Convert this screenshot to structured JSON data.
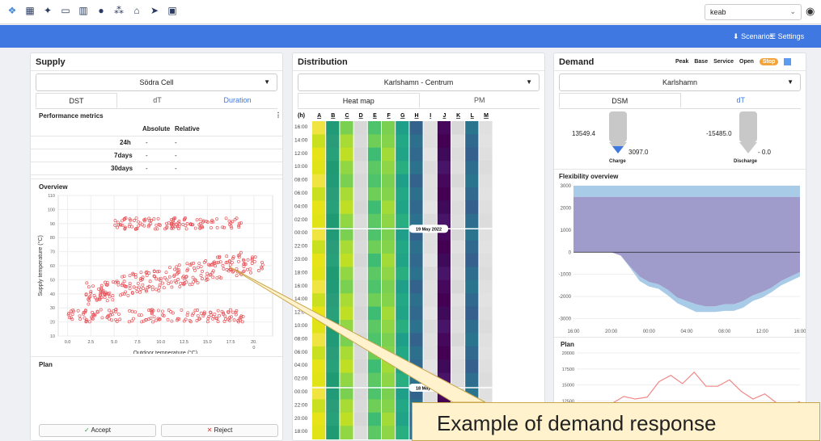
{
  "topbar": {
    "icons": [
      "app-logo-icon",
      "map-icon",
      "bell-icon",
      "monitor-icon",
      "building-icon",
      "clock-icon",
      "network-icon",
      "home-icon",
      "send-icon",
      "calendar-icon"
    ],
    "user_select": "keab"
  },
  "navbar": {
    "scenarios": "Scenarios",
    "settings": "Settings"
  },
  "supply": {
    "title": "Supply",
    "plant": "Södra Cell",
    "tabs": [
      "DST",
      "dT",
      "Duration"
    ],
    "performance_title": "Performance metrics",
    "col_absolute": "Absolute",
    "col_relative": "Relative",
    "rows": [
      {
        "label": "24h",
        "abs": "-",
        "rel": "-"
      },
      {
        "label": "7days",
        "abs": "-",
        "rel": "-"
      },
      {
        "label": "30days",
        "abs": "-",
        "rel": "-"
      }
    ],
    "overview_title": "Overview",
    "plan_title": "Plan",
    "accept": "Accept",
    "reject": "Reject"
  },
  "scatter_data": {
    "type": "scatter",
    "xlabel": "Outdoor temperature (°C)",
    "ylabel": "Supply temperature (°C)",
    "xlim": [
      -1,
      22
    ],
    "ylim": [
      10,
      110
    ],
    "x_ticks": [
      "0.0",
      "2.5",
      "5.0",
      "7.5",
      "10.0",
      "12.5",
      "15.0",
      "17.5",
      "20."
    ],
    "y_ticks": [
      "10",
      "20",
      "30",
      "40",
      "50",
      "60",
      "70",
      "80",
      "90",
      "100",
      "110"
    ],
    "x_tick_extra": "0",
    "color": "#e8545a"
  },
  "distribution": {
    "title": "Distribution",
    "area": "Karlshamn - Centrum",
    "tabs": [
      "Heat map",
      "PM"
    ],
    "hours_header": "(h)",
    "columns": [
      "A",
      "B",
      "C",
      "D",
      "E",
      "F",
      "G",
      "H",
      "I",
      "J",
      "K",
      "L",
      "M"
    ],
    "row_labels": [
      "16:00",
      "14:00",
      "12:00",
      "10:00",
      "08:00",
      "06:00",
      "04:00",
      "02:00",
      "00:00",
      "22:00",
      "20:00",
      "18:00",
      "16:00",
      "14:00",
      "12:00",
      "10:00",
      "08:00",
      "06:00",
      "04:00",
      "02:00",
      "00:00",
      "22:00",
      "20:00",
      "18:00"
    ],
    "date_label_1": "19 May 2022",
    "date_label_2": "18 May 2022"
  },
  "demand": {
    "title": "Demand",
    "pills": [
      "Peak",
      "Base",
      "Service",
      "Open",
      "Stop"
    ],
    "area": "Karlshamn",
    "tabs": [
      "DSM",
      "dT"
    ],
    "charge_label": "Charge",
    "discharge_label": "Discharge",
    "charge_left": "13549.4",
    "charge_right": "3097.0",
    "discharge_left": "-15485.0",
    "discharge_right": "- 0.0",
    "flex_title": "Flexibility overview",
    "plan_title": "Plan"
  },
  "flex_chart": {
    "type": "area",
    "x_ticks": [
      "16:00",
      "20:00",
      "00:00",
      "04:00",
      "08:00",
      "12:00",
      "16:00"
    ],
    "y_ticks": [
      "3000",
      "2000",
      "1000",
      "0",
      "-1000",
      "-2000",
      "-3000"
    ],
    "ylim": [
      -3200,
      3000
    ],
    "upper_limit": [
      3000,
      3000,
      3000,
      3000,
      3000,
      3000,
      3000,
      3000,
      3000,
      3000,
      3000,
      3000,
      3000,
      3000,
      3000,
      3000,
      3000,
      3000,
      3000,
      3000,
      3000,
      3000,
      3000,
      3000,
      3000
    ],
    "upper": [
      2500,
      2500,
      2500,
      2500,
      2500,
      2500,
      2500,
      2500,
      2500,
      2500,
      2500,
      2500,
      2500,
      2500,
      2500,
      2500,
      2500,
      2500,
      2500,
      2500,
      2500,
      2500,
      2500,
      2500,
      2500
    ],
    "lower": [
      0,
      0,
      0,
      0,
      0,
      -150,
      -650,
      -1100,
      -1350,
      -1450,
      -1700,
      -2050,
      -2200,
      -2350,
      -2450,
      -2450,
      -2350,
      -2350,
      -2200,
      -1950,
      -1800,
      -1600,
      -1300,
      -1100,
      -900
    ],
    "lower_limit": [
      0,
      0,
      0,
      0,
      0,
      -150,
      -700,
      -1300,
      -1550,
      -1650,
      -1950,
      -2300,
      -2500,
      -2700,
      -2700,
      -2700,
      -2650,
      -2650,
      -2500,
      -2200,
      -2050,
      -1800,
      -1500,
      -1300,
      -1100
    ],
    "colors": {
      "light": "#a8cbe8",
      "dark": "#9f9ccc"
    }
  },
  "plan_chart": {
    "type": "line",
    "y_ticks": [
      "20000",
      "17500",
      "15000",
      "12500"
    ],
    "ylim": [
      10000,
      20000
    ],
    "values": [
      10200,
      11000,
      11600,
      12100,
      13200,
      12800,
      13100,
      15500,
      16500,
      15200,
      17000,
      14800,
      14800,
      15800,
      14000,
      12800,
      13600,
      12200,
      11700,
      12400
    ],
    "color": "#ef8a88"
  },
  "callout": {
    "text": "Example of demand response"
  }
}
